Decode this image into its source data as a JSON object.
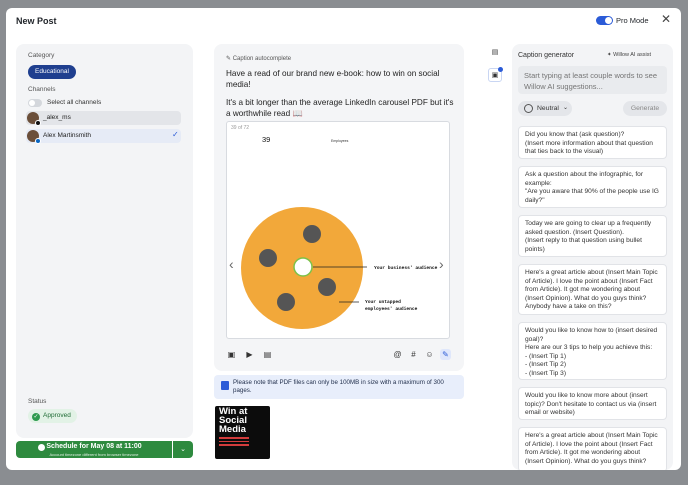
{
  "header": {
    "title": "New Post",
    "pro_mode_label": "Pro Mode",
    "close_label": "✕"
  },
  "left": {
    "category_label": "Category",
    "category_value": "Educational",
    "channels_label": "Channels",
    "select_all_label": "Select all channels",
    "channels": [
      {
        "name": "_alex_ms",
        "selected": false
      },
      {
        "name": "Alex Martinsmith",
        "selected": true
      }
    ],
    "check_mark": "✓",
    "status_label": "Status",
    "status_value": "Approved",
    "schedule_label": "Schedule for May 08 at 11:00",
    "schedule_sub": "Account timezone different from browser timezone",
    "schedule_caret": "⌄"
  },
  "editor": {
    "autocomplete_label": "Caption autocomplete",
    "paragraph1": "Have a read of our brand new e-book: how to win on social media!",
    "paragraph2": "It's a bit longer than the average LinkedIn carousel PDF but it's a worthwhile read 📖",
    "page_counter": "39 of 72",
    "slide_number": "39",
    "slide_employees": "Employees",
    "slide_audience": "Your business' audience",
    "slide_untapped_1": "Your untapped",
    "slide_untapped_2": "employees' audience",
    "prev_arrow": "‹",
    "next_arrow": "›",
    "toolbar": {
      "image": "▣",
      "video": "▶",
      "document": "▤",
      "mention": "@",
      "hashtag": "#",
      "emoji": "☺",
      "magic": "✎"
    }
  },
  "info": {
    "message": "Please note that PDF files can only be 100MB in size with a maximum of 300 pages."
  },
  "thumbnail": {
    "title_line1": "Win at",
    "title_line2": "Social",
    "title_line3": "Media"
  },
  "side_icons": {
    "document": "▤",
    "image": "▣"
  },
  "caption": {
    "title": "Caption generator",
    "assist_label": "Willow AI assist",
    "input_placeholder": "Start typing at least couple words to see Willow AI suggestions...",
    "tone_label": "Neutral",
    "tone_caret": "⌄",
    "generate_label": "Generate",
    "suggestions": [
      "Did you know that (ask question)?\n(Insert more information about that question that ties back to the visual)",
      "Ask a question about the infographic, for example:\n\"Are you aware that 90% of the people use IG daily?\"",
      "Today we are going to clear up a frequently asked question. (Insert Question).\n(Insert reply to that question using bullet points)",
      "Here's a great article about (Insert Main Topic of Article). I love the point about (Insert Fact from Article). It got me wondering about (Insert Opinion). What do you guys think? Anybody have a take on this?",
      "Would you like to know how to (insert desired goal)?\nHere are our 3 tips to help you achieve this:\n- (Insert Tip 1)\n- (Insert Tip 2)\n- (Insert Tip 3)",
      "Would you like to know more about (insert topic)? Don't hesitate to contact us via (insert email or website)",
      "Here's a great article about (Insert Main Topic of Article). I love the point about (Insert Fact from Article). It got me wondering about (Insert Opinion). What do you guys think?"
    ]
  },
  "colors": {
    "accent": "#2b5bd7",
    "category_pill": "#1f3f8f",
    "schedule_green": "#2e8a3f",
    "slide_circle": "#f2a83a"
  }
}
